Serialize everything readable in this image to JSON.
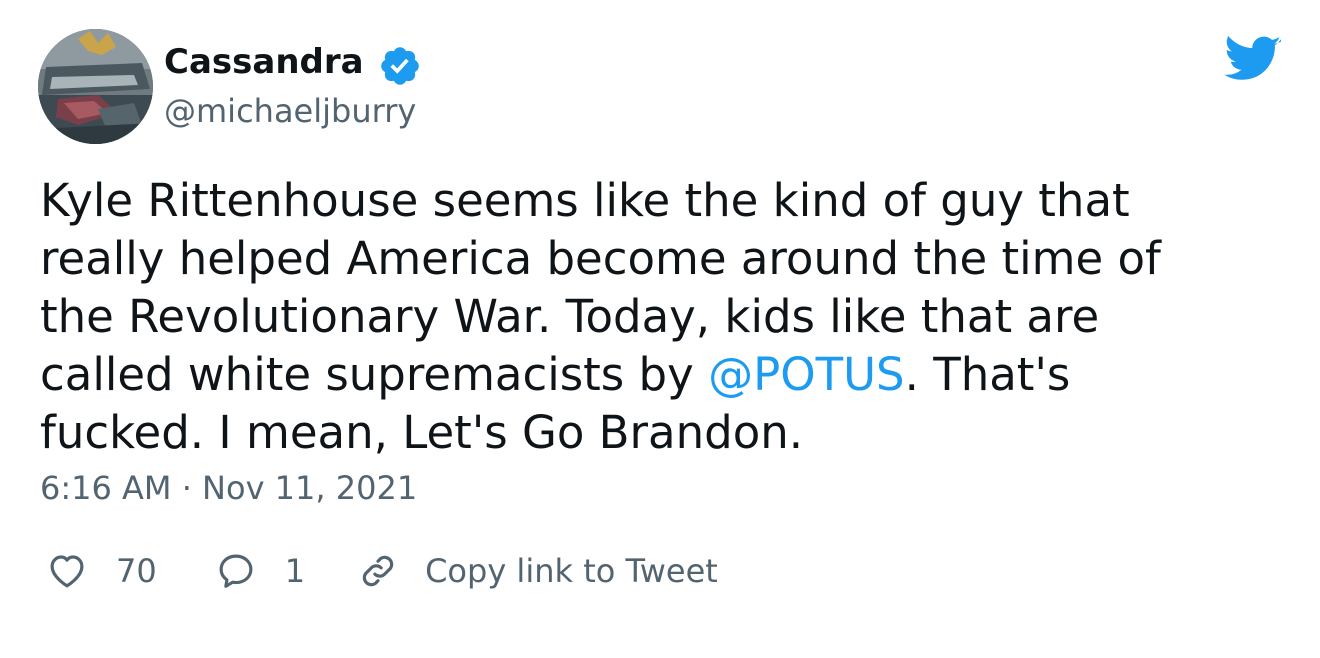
{
  "author": {
    "name": "Cassandra",
    "handle": "@michaeljburry",
    "verified": true,
    "avatar_icon": "avatar-photo"
  },
  "brand": {
    "icon": "twitter-bird-icon",
    "color": "#1d9bf0"
  },
  "tweet": {
    "text_before_mention": "Kyle Rittenhouse seems like the kind of guy that\nreally helped America become around the time of\nthe Revolutionary War. Today, kids like that are\ncalled white supremacists by ",
    "mention": "@POTUS",
    "text_after_mention": ".  That's\nfucked. I mean, Let's Go Brandon.",
    "timestamp": "6:16 AM · Nov 11, 2021"
  },
  "actions": {
    "likes_count": "70",
    "replies_count": "1",
    "copy_link_label": "Copy link to Tweet"
  },
  "colors": {
    "text": "#0f1419",
    "secondary": "#536471",
    "accent": "#1d9bf0"
  }
}
